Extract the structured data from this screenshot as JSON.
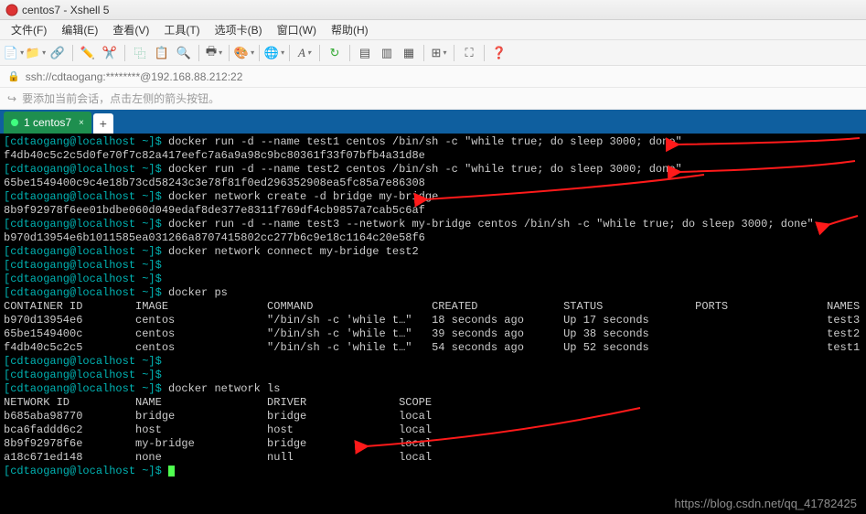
{
  "window": {
    "title": "centos7 - Xshell 5"
  },
  "menu": {
    "file": "文件(F)",
    "edit": "编辑(E)",
    "view": "查看(V)",
    "tools": "工具(T)",
    "tabs": "选项卡(B)",
    "window": "窗口(W)",
    "help": "帮助(H)"
  },
  "ssh": {
    "url": "ssh://cdtaogang:********@192.168.88.212:22"
  },
  "hint": {
    "text": "要添加当前会话，点击左侧的箭头按钮。"
  },
  "tab": {
    "label": "1 centos7"
  },
  "term": {
    "prompt": "[cdtaogang@localhost ~]$",
    "l1cmd": " docker run -d --name test1 centos /bin/sh -c \"while true; do sleep 3000; done\"",
    "l2": "f4db40c5c2c5d0fe70f7c82a417eefc7a6a9a98c9bc80361f33f07bfb4a31d8e",
    "l3cmd": " docker run -d --name test2 centos /bin/sh -c \"while true; do sleep 3000; done\"",
    "l4": "65be1549400c9c4e18b73cd58243c3e78f81f0ed296352908ea5fc85a7e86308",
    "l5cmd": " docker network create -d bridge my-bridge",
    "l6": "8b9f92978f6ee01bdbe060d049edaf8de377e8311f769df4cb9857a7cab5c6af",
    "l7cmd": " docker run -d --name test3 --network my-bridge centos /bin/sh -c \"while true; do sleep 3000; done\"",
    "l8": "b970d13954e6b1011585ea031266a8707415802cc277b6c9e18c1164c20e58f6",
    "l9cmd": " docker network connect my-bridge test2",
    "l12cmd": " docker ps",
    "hdr": "CONTAINER ID        IMAGE               COMMAND                  CREATED             STATUS              PORTS               NAMES",
    "row1": "b970d13954e6        centos              \"/bin/sh -c 'while t…\"   18 seconds ago      Up 17 seconds                           test3",
    "row2": "65be1549400c        centos              \"/bin/sh -c 'while t…\"   39 seconds ago      Up 38 seconds                           test2",
    "row3": "f4db40c5c2c5        centos              \"/bin/sh -c 'while t…\"   54 seconds ago      Up 52 seconds                           test1",
    "l16cmd": " docker network ls",
    "nhdr": "NETWORK ID          NAME                DRIVER              SCOPE",
    "nrow1": "b685aba98770        bridge              bridge              local",
    "nrow2": "bca6faddd6c2        host                host                local",
    "nrow3": "8b9f92978f6e        my-bridge           bridge              local",
    "nrow4": "a18c671ed148        none                null                local"
  },
  "watermark": "https://blog.csdn.net/qq_41782425"
}
